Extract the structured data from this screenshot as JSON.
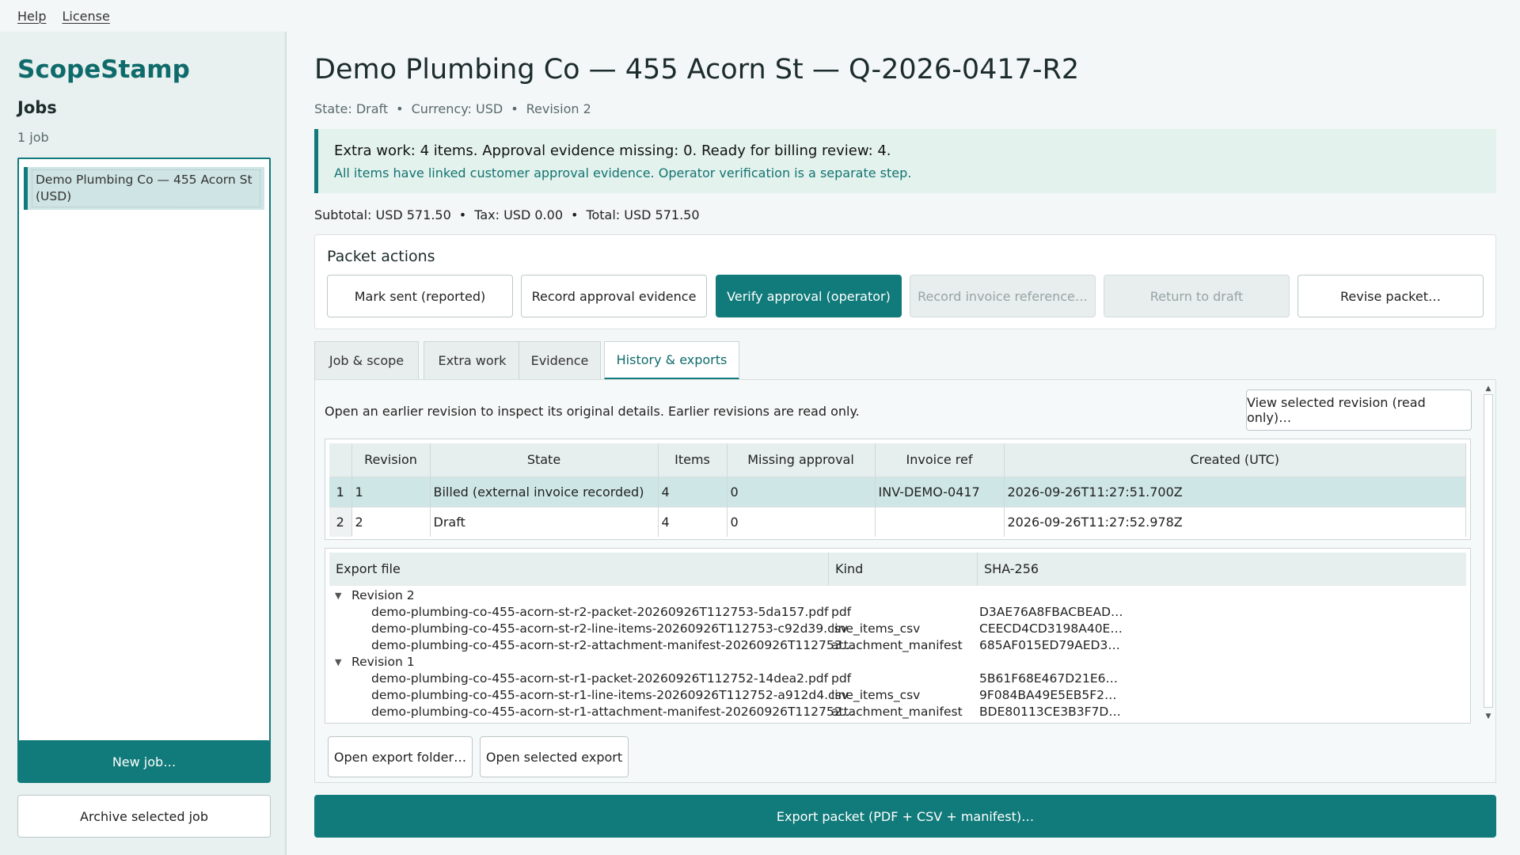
{
  "menu": {
    "help": "Help",
    "license": "License"
  },
  "sidebar": {
    "brand": "ScopeStamp",
    "jobs_title": "Jobs",
    "job_count": "1 job",
    "jobs": [
      {
        "label": "Demo Plumbing Co — 455 Acorn St (USD)"
      }
    ],
    "new_job": "New job…",
    "archive_job": "Archive selected job"
  },
  "header": {
    "title": "Demo Plumbing Co — 455 Acorn St — Q-2026-0417-R2",
    "state": "State: Draft",
    "currency": "Currency: USD",
    "revision": "Revision 2",
    "separator": "•"
  },
  "banner": {
    "main": "Extra work: 4 items. Approval evidence missing: 0. Ready for billing review: 4.",
    "sub": "All items have linked customer approval evidence. Operator verification is a separate step."
  },
  "totals": {
    "subtotal": "Subtotal: USD 571.50",
    "tax": "Tax: USD 0.00",
    "total": "Total: USD 571.50"
  },
  "actions": {
    "title": "Packet actions",
    "mark_sent": "Mark sent (reported)",
    "record_evidence": "Record approval evidence",
    "verify": "Verify approval (operator)",
    "record_invoice": "Record invoice reference…",
    "return_draft": "Return to draft",
    "revise": "Revise packet…"
  },
  "tabs": [
    "Job & scope",
    "Extra work",
    "Evidence",
    "History & exports"
  ],
  "history": {
    "description": "Open an earlier revision to inspect its original details. Earlier revisions are read only.",
    "view_button": "View selected revision (read only)…",
    "columns": [
      "Revision",
      "State",
      "Items",
      "Missing approval",
      "Invoice ref",
      "Created (UTC)"
    ],
    "rows": [
      {
        "num": "1",
        "revision": "1",
        "state": "Billed (external invoice recorded)",
        "items": "4",
        "missing": "0",
        "invoice": "INV-DEMO-0417",
        "created": "2026-09-26T11:27:51.700Z"
      },
      {
        "num": "2",
        "revision": "2",
        "state": "Draft",
        "items": "4",
        "missing": "0",
        "invoice": "",
        "created": "2026-09-26T11:27:52.978Z"
      }
    ]
  },
  "exports": {
    "columns": [
      "Export file",
      "Kind",
      "SHA-256"
    ],
    "groups": [
      {
        "label": "Revision 2",
        "files": [
          {
            "name": "demo-plumbing-co-455-acorn-st-r2-packet-20260926T112753-5da157.pdf",
            "kind": "pdf",
            "sha": "D3AE76A8FBACBEAD…"
          },
          {
            "name": "demo-plumbing-co-455-acorn-st-r2-line-items-20260926T112753-c92d39.csv",
            "kind": "line_items_csv",
            "sha": "CEECD4CD3198A40E…"
          },
          {
            "name": "demo-plumbing-co-455-acorn-st-r2-attachment-manifest-20260926T112753…",
            "kind": "attachment_manifest",
            "sha": "685AF015ED79AED3…"
          }
        ]
      },
      {
        "label": "Revision 1",
        "files": [
          {
            "name": "demo-plumbing-co-455-acorn-st-r1-packet-20260926T112752-14dea2.pdf",
            "kind": "pdf",
            "sha": "5B61F68E467D21E6…"
          },
          {
            "name": "demo-plumbing-co-455-acorn-st-r1-line-items-20260926T112752-a912d4.csv",
            "kind": "line_items_csv",
            "sha": "9F084BA49E5EB5F2…"
          },
          {
            "name": "demo-plumbing-co-455-acorn-st-r1-attachment-manifest-20260926T112752…",
            "kind": "attachment_manifest",
            "sha": "BDE80113CE3B3F7D…"
          }
        ]
      }
    ],
    "open_folder": "Open export folder…",
    "open_selected": "Open selected export"
  },
  "export_packet": "Export packet (PDF + CSV + manifest)…",
  "colors": {
    "accent": "#117a7a",
    "banner_bg": "#e3f2ec",
    "selection": "#cfe6e6"
  }
}
